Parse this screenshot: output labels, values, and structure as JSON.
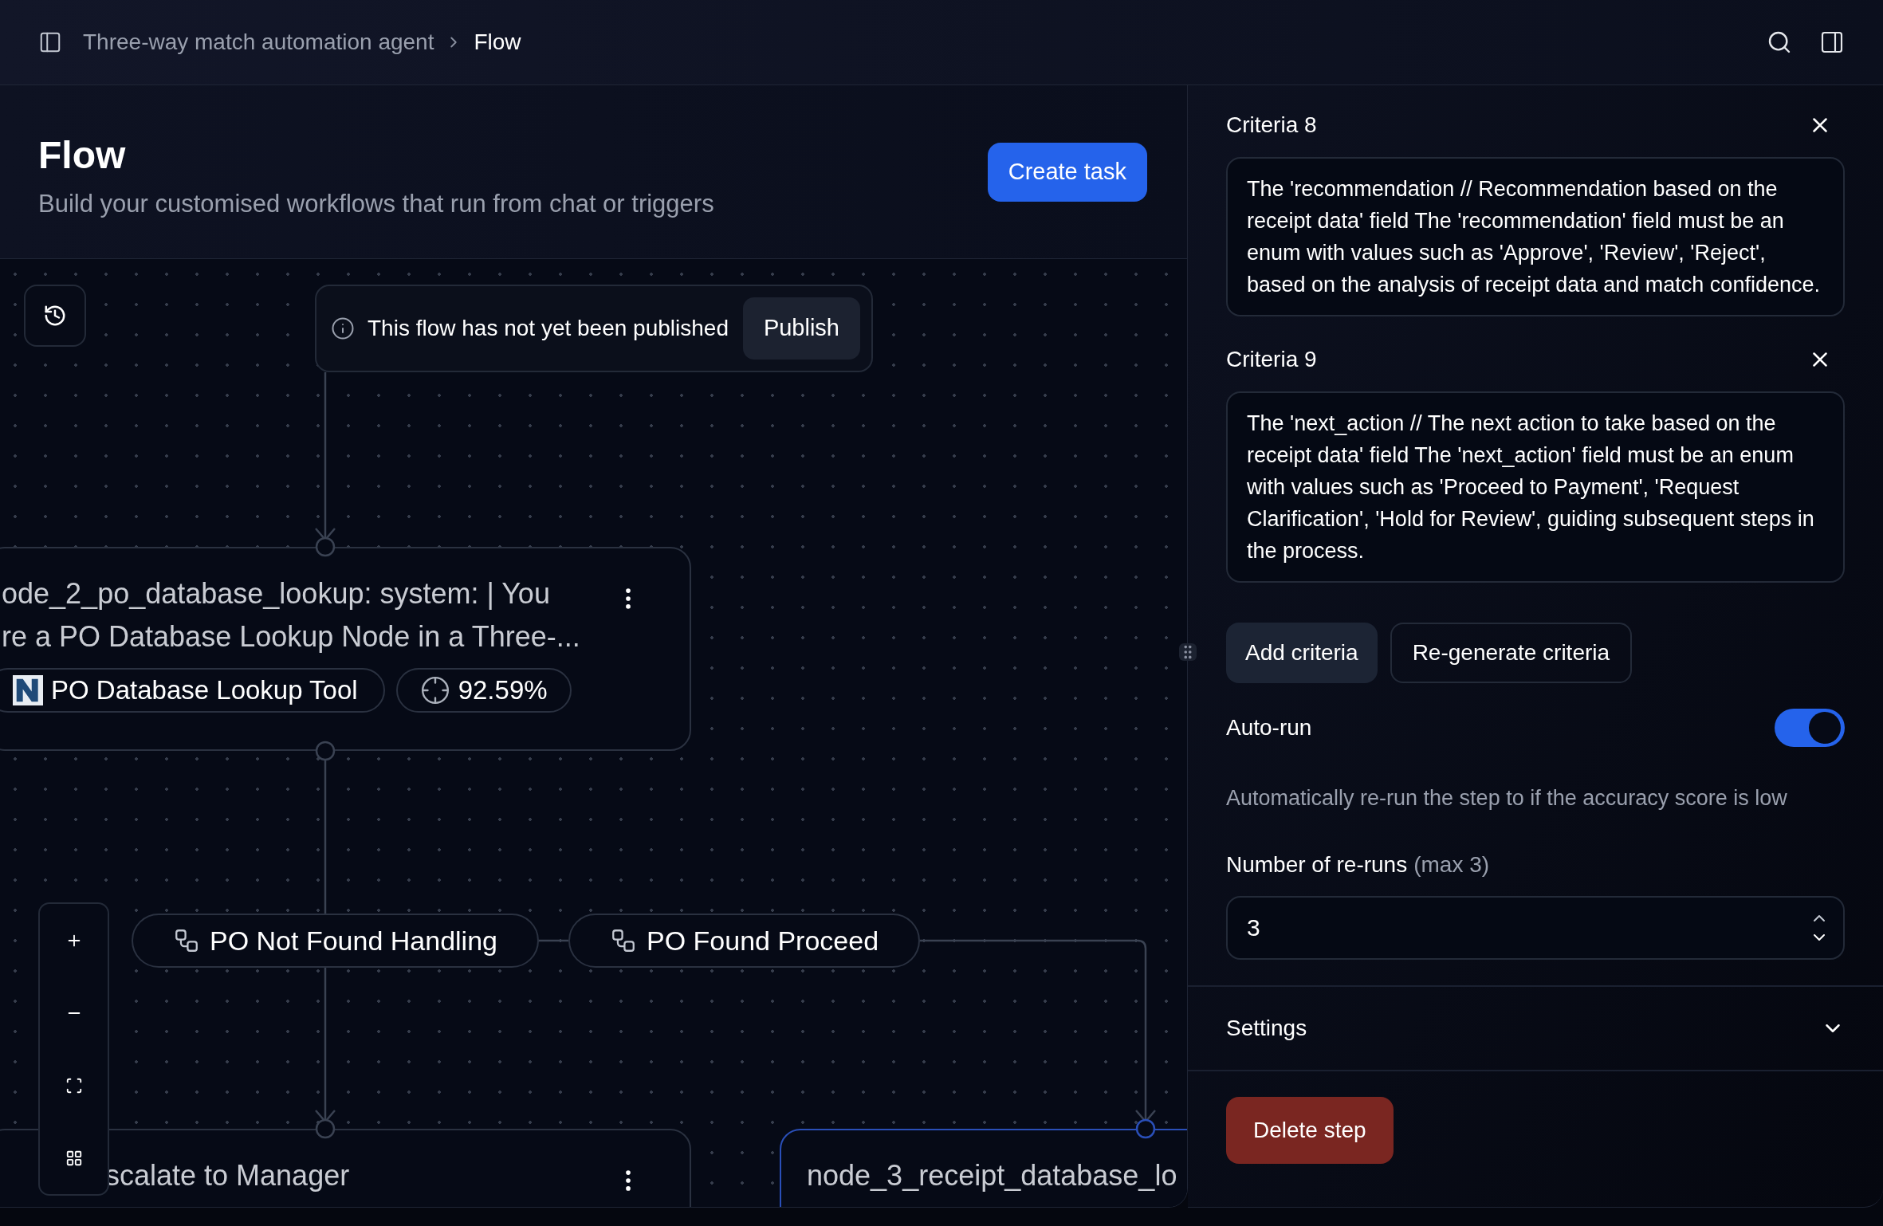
{
  "breadcrumb": [
    {
      "label": "Three-way match automation agent",
      "selected": false
    },
    {
      "label": "Flow",
      "selected": true
    }
  ],
  "header": {
    "title": "Flow",
    "subtitle": "Build your customised workflows that run from chat or triggers",
    "create_button": "Create task"
  },
  "publish_banner": {
    "message": "This flow has not yet been published",
    "button": "Publish"
  },
  "nodes": [
    {
      "title_lines": [
        "ode_2_po_database_lookup: system: | You",
        "re a PO Database Lookup Node in a Three-..."
      ],
      "selected": false,
      "tool": "PO Database Lookup Tool",
      "score": "92.59%"
    },
    {
      "title_lines": [
        "scalate to Manager"
      ],
      "selected": false
    },
    {
      "title_lines": [
        "node_3_receipt_database_lo"
      ],
      "selected": true
    }
  ],
  "edge_labels": [
    "PO Not Found Handling",
    "PO Found Proceed"
  ],
  "panel": {
    "criteria": [
      {
        "label": "Criteria 8",
        "text": "The 'recommendation // Recommendation based on the receipt data' field The 'recommendation' field must be an enum with values such as 'Approve', 'Review', 'Reject', based on the analysis of receipt data and match confidence."
      },
      {
        "label": "Criteria 9",
        "text": "The 'next_action // The next action to take based on the receipt data' field The 'next_action' field must be an enum with values such as 'Proceed to Payment', 'Request Clarification', 'Hold for Review', guiding subsequent steps in the process."
      }
    ],
    "add_button": "Add criteria",
    "regenerate_button": "Re-generate criteria",
    "auto_run": {
      "label": "Auto-run",
      "on": true,
      "description": "Automatically re-run the step to if the accuracy score is low"
    },
    "reruns": {
      "label": "Number of re-runs",
      "hint": "(max 3)",
      "value": "3"
    },
    "settings": {
      "label": "Settings",
      "expanded": false
    },
    "delete_button": "Delete step"
  }
}
